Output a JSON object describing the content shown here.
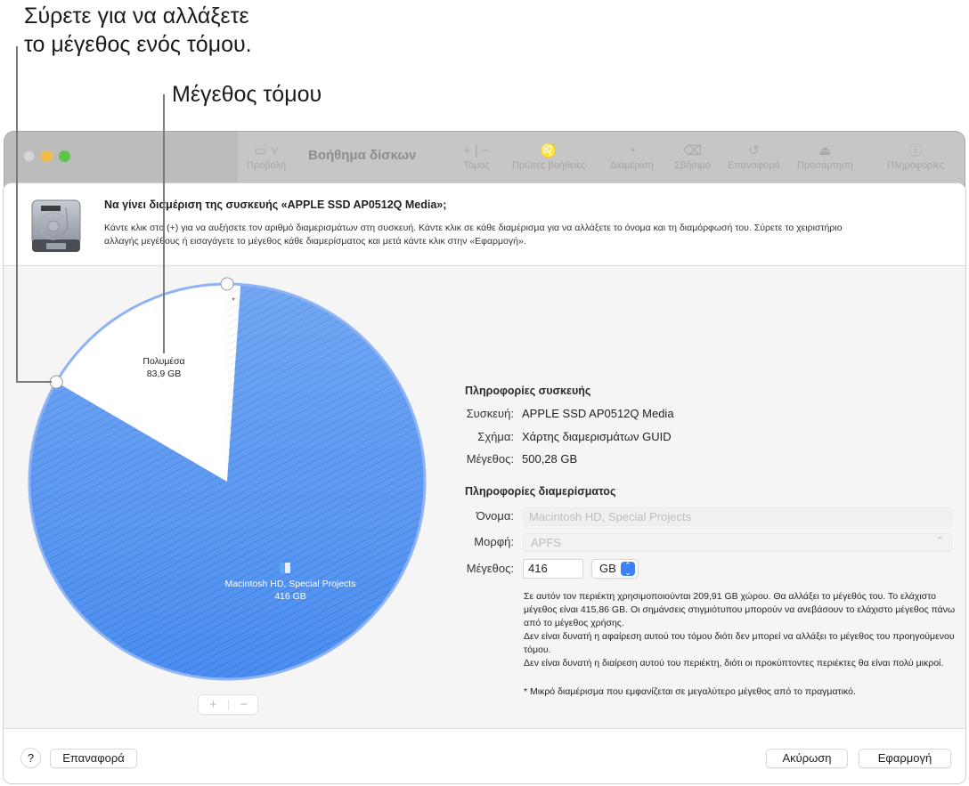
{
  "callouts": {
    "resize_hint_line1": "Σύρετε για να αλλάξετε",
    "resize_hint_line2": "το μέγεθος ενός τόμου.",
    "volume_size": "Μέγεθος τόμου"
  },
  "window": {
    "title": "Βοήθημα δίσκων",
    "toolbar": {
      "view_label": "Προβολή",
      "volume_label": "Τόμος",
      "first_aid_label": "Πρώτες βοήθειες",
      "partition_label": "Διαμέριση",
      "erase_label": "Σβήσιμο",
      "restore_label": "Επαναφορά",
      "mount_label": "Προσάρτηση",
      "info_label": "Πληροφορίες"
    }
  },
  "sheet": {
    "title": "Να γίνει διαμέριση της συσκευής «APPLE SSD AP0512Q Media»;",
    "description": "Κάντε κλικ στο (+) για να αυξήσετε τον αριθμό διαμερισμάτων στη συσκευή. Κάντε κλικ σε κάθε διαμέρισμα για να αλλάξετε το όνομα και τη διαμόρφωσή του. Σύρετε το χειριστήριο αλλαγής μεγέθους ή εισαγάγετε το μέγεθος κάθε διαμερίσματος και μετά κάντε κλικ στην «Εφαρμογή»."
  },
  "chart_data": {
    "type": "pie",
    "title": "",
    "total_gb": 500.28,
    "slices": [
      {
        "name": "Macintosh HD, Special Projects",
        "label_value": "416 GB",
        "value_gb": 416,
        "style": "blue-hatched",
        "selected": true
      },
      {
        "name": "Πολυμέσα",
        "label_value": "83,9 GB",
        "value_gb": 83.9,
        "style": "white"
      },
      {
        "name": "*",
        "label_value": "",
        "value_gb": 0.38,
        "style": "gray-hatched",
        "note": "small partition shown larger than actual"
      }
    ],
    "colors": {
      "blue": "#3f86ee",
      "blue_light": "#6aa3f2",
      "ring": "#8fb3f5"
    }
  },
  "device_info": {
    "heading": "Πληροφορίες συσκευής",
    "device_label": "Συσκευή:",
    "device_value": "APPLE SSD AP0512Q Media",
    "scheme_label": "Σχήμα:",
    "scheme_value": "Χάρτης διαμερισμάτων GUID",
    "size_label": "Μέγεθος:",
    "size_value": "500,28 GB"
  },
  "partition_info": {
    "heading": "Πληροφορίες διαμερίσματος",
    "name_label": "Όνομα:",
    "name_placeholder": "Macintosh HD, Special Projects",
    "format_label": "Μορφή:",
    "format_value": "APFS",
    "size_label": "Μέγεθος:",
    "size_value": "416",
    "unit_value": "GB",
    "notes": [
      "Σε αυτόν τον περιέκτη χρησιμοποιούνται 209,91 GB χώρου. Θα αλλάξει το μέγεθός του. Το ελάχιστο μέγεθος είναι 415,86 GB. Οι σημάνσεις στιγμιότυπου μπορούν να ανεβάσουν το ελάχιστο μέγεθος πάνω από το μέγεθος χρήσης.",
      "Δεν είναι δυνατή η αφαίρεση αυτού του τόμου διότι δεν μπορεί να αλλάξει το μέγεθος του προηγούμενου τόμου.",
      "Δεν είναι δυνατή η διαίρεση αυτού του περιέκτη, διότι οι προκύπτοντες περιέκτες θα είναι πολύ μικροί."
    ],
    "footnote": "* Μικρό διαμέρισμα που εμφανίζεται σε μεγαλύτερο μέγεθος από το πραγματικό."
  },
  "pie_controls": {
    "add": "+",
    "remove": "−"
  },
  "footer": {
    "help": "?",
    "revert": "Επαναφορά",
    "cancel": "Ακύρωση",
    "apply": "Εφαρμογή"
  }
}
